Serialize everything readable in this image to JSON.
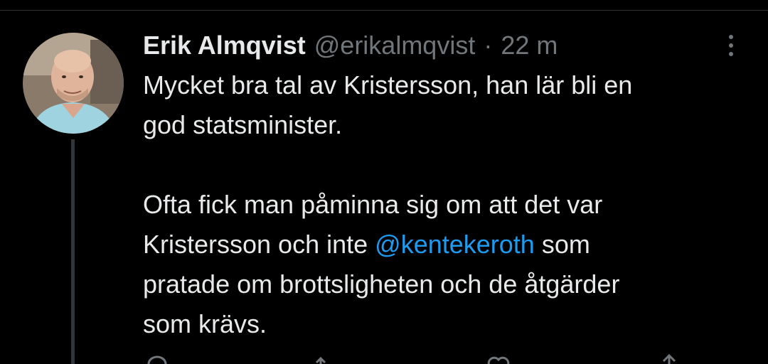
{
  "tweet": {
    "display_name": "Erik Almqvist",
    "handle": "@erikalmqvist",
    "separator": "·",
    "time": "22 m",
    "text_part1": "Mycket bra tal av Kristersson, han lär bli en\ngod statsminister.\n\nOfta fick man påminna sig om att det var\nKristersson och inte ",
    "mention": "@kentekeroth",
    "text_part2": " som\npratade om brottsligheten och de åtgärder\nsom krävs."
  },
  "colors": {
    "background": "#000000",
    "text": "#e7e9ea",
    "muted": "#71767b",
    "link": "#1d9bf0"
  },
  "icons": {
    "more": "more-vertical-icon",
    "reply": "reply-icon",
    "retweet": "retweet-icon",
    "like": "heart-icon",
    "share": "share-icon"
  }
}
